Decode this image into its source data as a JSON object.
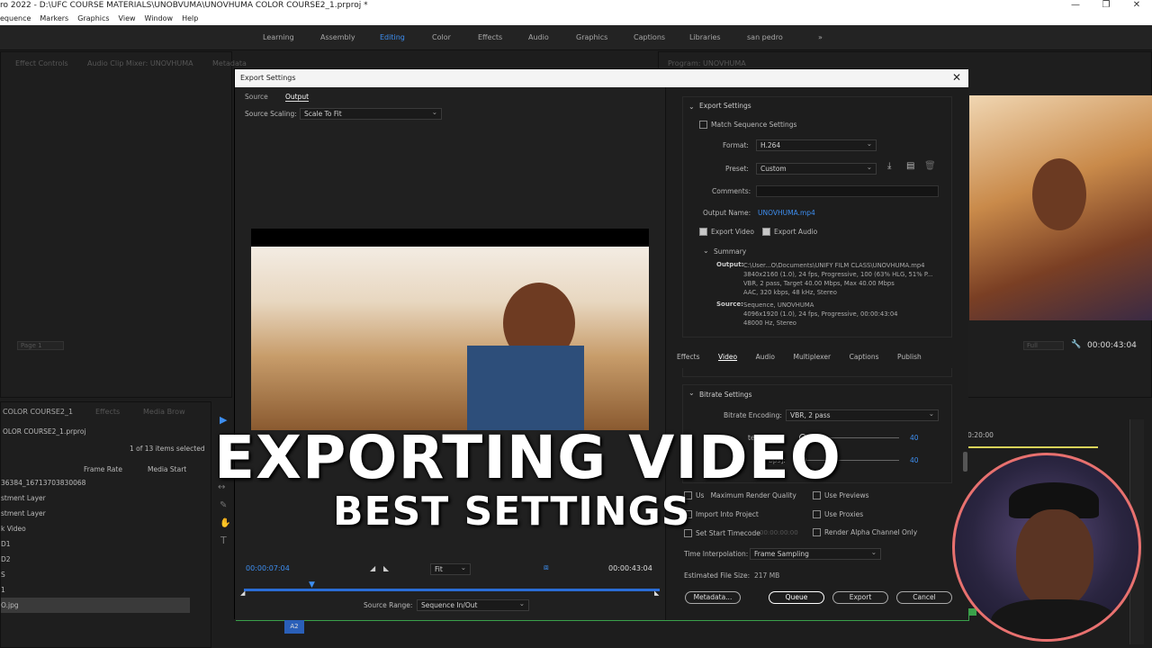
{
  "window": {
    "title": "ro 2022 - D:\\UFC COURSE MATERIALS\\UNOBVUMA\\UNOVHUMA COLOR COURSE2_1.prproj *",
    "controls": [
      "—",
      "❐",
      "✕"
    ]
  },
  "menu": [
    "equence",
    "Markers",
    "Graphics",
    "View",
    "Window",
    "Help"
  ],
  "workspaces": {
    "items": [
      "Learning",
      "Assembly",
      "Editing",
      "Color",
      "Effects",
      "Audio",
      "Graphics",
      "Captions",
      "Libraries",
      "san pedro"
    ],
    "active": "Editing",
    "more": "»"
  },
  "source_panel": {
    "tabs": [
      "Effect Controls",
      "Audio Clip Mixer: UNOVHUMA",
      "Metadata"
    ],
    "page": "Page 1"
  },
  "program_panel": {
    "title": "Program: UNOVHUMA",
    "fit": "Full",
    "timecode": "00:00:43:04"
  },
  "project_panel": {
    "tabs": [
      "COLOR COURSE2_1",
      "Effects",
      "Media Brow"
    ],
    "project_file": "OLOR COURSE2_1.prproj",
    "selection_info": "1 of 13 items selected",
    "columns": [
      "Frame Rate",
      "Media Start"
    ],
    "rows": [
      "36384_16713703830068",
      "stment Layer",
      "stment Layer",
      "k Video",
      "D1",
      "D2",
      "S",
      "1",
      "O.jpg"
    ]
  },
  "timeline": {
    "timecode": "0:20:00",
    "track_label": "A2"
  },
  "export_dialog": {
    "title": "Export Settings",
    "close": "✕",
    "left_tabs": [
      "Source",
      "Output"
    ],
    "active_left_tab": "Output",
    "source_scaling_label": "Source Scaling:",
    "source_scaling_value": "Scale To Fit",
    "current_time": "00:00:07:04",
    "fit_value": "Fit",
    "end_time": "00:00:43:04",
    "source_range_label": "Source Range:",
    "source_range_value": "Sequence In/Out",
    "export_settings": {
      "section": "Export Settings",
      "match_sequence": "Match Sequence Settings",
      "format_label": "Format:",
      "format_value": "H.264",
      "preset_label": "Preset:",
      "preset_value": "Custom",
      "comments_label": "Comments:",
      "output_name_label": "Output Name:",
      "output_name_value": "UNOVHUMA.mp4",
      "export_video": "Export Video",
      "export_audio": "Export Audio",
      "summary": "Summary",
      "output_label": "Output:",
      "output_lines": [
        "C:\\User...O\\Documents\\UNIFY FILM CLASS\\UNOVHUMA.mp4",
        "3840x2160 (1.0), 24 fps, Progressive, 100 (63% HLG, 51% P...",
        "VBR, 2 pass, Target 40.00 Mbps, Max 40.00 Mbps",
        "AAC, 320 kbps, 48 kHz, Stereo"
      ],
      "source_label": "Source:",
      "source_lines": [
        "Sequence, UNOVHUMA",
        "4096x1920 (1.0), 24 fps, Progressive, 00:00:43:04",
        "48000 Hz, Stereo"
      ]
    },
    "right_tabs": [
      "Effects",
      "Video",
      "Audio",
      "Multiplexer",
      "Captions",
      "Publish"
    ],
    "active_right_tab": "Video",
    "bitrate": {
      "section": "Bitrate Settings",
      "encoding_label": "Bitrate Encoding:",
      "encoding_value": "VBR, 2 pass",
      "target_label": "te [",
      "target_value": "40",
      "max_label": "bps]:",
      "max_value": "40"
    },
    "options": {
      "max_render": "Use Maximum Render Quality",
      "max_render_visible": "Us",
      "max_render_tail": "Maximum Render Quality",
      "use_previews": "Use Previews",
      "import_project": "Import Into Project",
      "use_proxies": "Use Proxies",
      "set_start_tc": "Set Start Timecode",
      "start_tc_value": "00:00:00:00",
      "render_alpha": "Render Alpha Channel Only",
      "time_interp_label": "Time Interpolation:",
      "time_interp_value": "Frame Sampling",
      "est_size_label": "Estimated File Size:",
      "est_size_value": "217 MB"
    },
    "buttons": {
      "metadata": "Metadata...",
      "queue": "Queue",
      "export": "Export",
      "cancel": "Cancel"
    }
  },
  "overlay": {
    "line1": "EXPORTING VIDEO",
    "line2": "BEST SETTINGS"
  },
  "colors": {
    "accent": "#3d8ef0",
    "panel": "#1e1e1e",
    "dialog": "#1f1f1f",
    "title_bar": "#f4f4f4",
    "webcam_ring": "#e8716f"
  }
}
